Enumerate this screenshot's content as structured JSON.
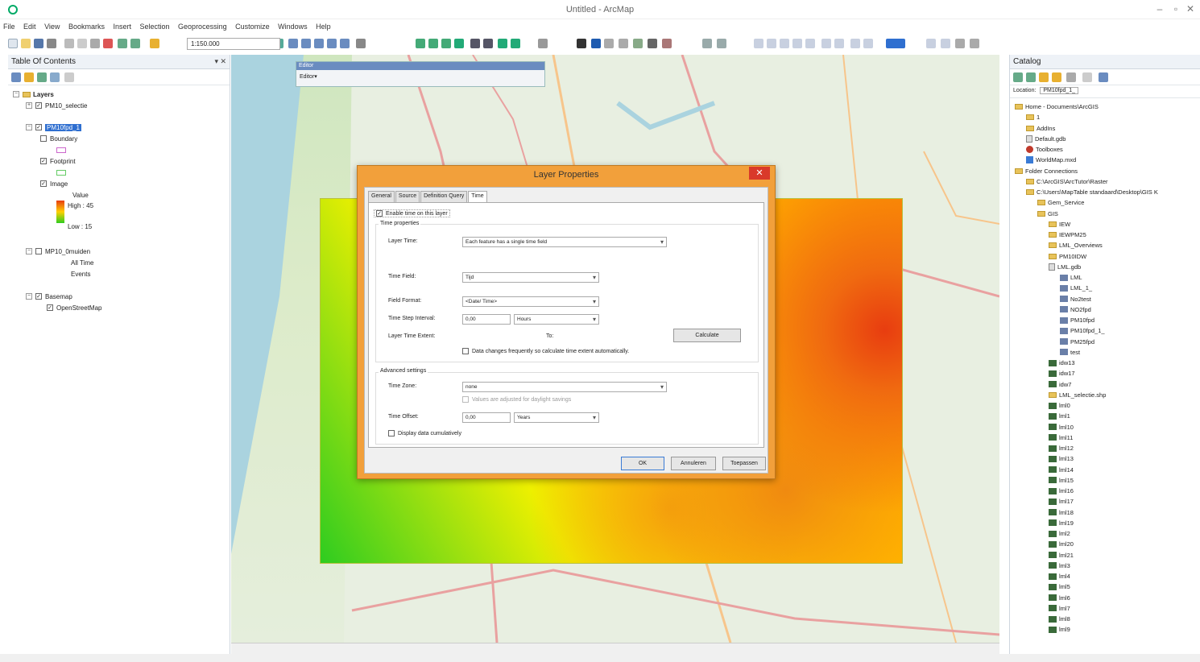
{
  "window": {
    "title": "Untitled - ArcMap",
    "min": "–",
    "max": "▫",
    "close": "✕"
  },
  "menu": [
    "File",
    "Edit",
    "View",
    "Bookmarks",
    "Insert",
    "Selection",
    "Geoprocessing",
    "Customize",
    "Windows",
    "Help"
  ],
  "toolbar": {
    "scale": "1:150.000"
  },
  "toc": {
    "title": "Table Of Contents",
    "pin": "▾ ✕",
    "layers_label": "Layers",
    "items": [
      {
        "label": "PM10_selectie"
      },
      {
        "label": "PM10fpd_1"
      },
      {
        "label": "Boundary"
      },
      {
        "label": "Footprint"
      },
      {
        "label": "Image"
      },
      {
        "label": "Value"
      },
      {
        "label": "High : 45"
      },
      {
        "label": "Low : 15"
      },
      {
        "label": "MP10_0muiden"
      },
      {
        "label": "All Time"
      },
      {
        "label": "Events"
      },
      {
        "label": "Basemap"
      },
      {
        "label": "OpenStreetMap"
      }
    ]
  },
  "editor": {
    "title": "Editor",
    "menu": "Editor▾"
  },
  "dialog": {
    "title": "Layer Properties",
    "close": "✕",
    "tabs": [
      "General",
      "Source",
      "Definition Query",
      "Time"
    ],
    "enable_time": "Enable time on this layer",
    "time_properties": "Time properties",
    "layer_time_label": "Layer Time:",
    "layer_time_value": "Each feature has a single time field",
    "time_field_label": "Time Field:",
    "time_field_value": "Tijd",
    "field_format_label": "Field Format:",
    "field_format_value": "<Date/ Time>",
    "time_step_label": "Time Step Interval:",
    "time_step_value": "0,00",
    "time_step_unit": "Hours",
    "layer_extent_label": "Layer Time Extent:",
    "layer_extent_to": "To:",
    "calculate": "Calculate",
    "data_changes": "Data changes frequently so calculate time extent automatically.",
    "advanced": "Advanced settings",
    "time_zone_label": "Time Zone:",
    "time_zone_value": "none",
    "daylight": "Values are adjusted for daylight savings",
    "time_offset_label": "Time Offset:",
    "time_offset_value": "0,00",
    "time_offset_unit": "Years",
    "display_cumulative": "Display data cumulatively",
    "ok": "OK",
    "cancel": "Annuleren",
    "apply": "Toepassen"
  },
  "catalog": {
    "title": "Catalog",
    "location_label": "Location:",
    "location_value": "PM10fpd_1_",
    "items": [
      {
        "label": "Home - Documents\\ArcGIS",
        "icon": "folder",
        "level": 0
      },
      {
        "label": "1",
        "icon": "folder",
        "level": 1
      },
      {
        "label": "AddIns",
        "icon": "folder",
        "level": 1
      },
      {
        "label": "Default.gdb",
        "icon": "gdb",
        "level": 1
      },
      {
        "label": "Toolboxes",
        "icon": "toolbox",
        "level": 1
      },
      {
        "label": "WorldMap.mxd",
        "icon": "mxd",
        "level": 1
      },
      {
        "label": "Folder Connections",
        "icon": "folder",
        "level": 0
      },
      {
        "label": "C:\\ArcGIS\\ArcTutor\\Raster",
        "icon": "folder",
        "level": 1
      },
      {
        "label": "C:\\Users\\MapTable standaard\\Desktop\\GIS K",
        "icon": "folder",
        "level": 1
      },
      {
        "label": "Gem_Service",
        "icon": "folder",
        "level": 2
      },
      {
        "label": "GIS",
        "icon": "folder",
        "level": 2
      },
      {
        "label": "IEW",
        "icon": "folder",
        "level": 3
      },
      {
        "label": "IEWPM25",
        "icon": "folder",
        "level": 3
      },
      {
        "label": "LML_Overviews",
        "icon": "folder",
        "level": 3
      },
      {
        "label": "PM10IDW",
        "icon": "folder",
        "level": 3
      },
      {
        "label": "LML.gdb",
        "icon": "gdb",
        "level": 3
      },
      {
        "label": "LML",
        "icon": "fc",
        "level": 4
      },
      {
        "label": "LML_1_",
        "icon": "fc",
        "level": 4
      },
      {
        "label": "No2test",
        "icon": "fc",
        "level": 4
      },
      {
        "label": "NO2fpd",
        "icon": "fc",
        "level": 4
      },
      {
        "label": "PM10fpd",
        "icon": "fc",
        "level": 4
      },
      {
        "label": "PM10fpd_1_",
        "icon": "fc",
        "level": 4
      },
      {
        "label": "PM25fpd",
        "icon": "fc",
        "level": 4
      },
      {
        "label": "test",
        "icon": "fc",
        "level": 4
      },
      {
        "label": "idw13",
        "icon": "raster",
        "level": 3
      },
      {
        "label": "idw17",
        "icon": "raster",
        "level": 3
      },
      {
        "label": "idw7",
        "icon": "raster",
        "level": 3
      },
      {
        "label": "LML_selectie.shp",
        "icon": "folder",
        "level": 3
      },
      {
        "label": "lml0",
        "icon": "raster",
        "level": 3
      },
      {
        "label": "lml1",
        "icon": "raster",
        "level": 3
      },
      {
        "label": "lml10",
        "icon": "raster",
        "level": 3
      },
      {
        "label": "lml11",
        "icon": "raster",
        "level": 3
      },
      {
        "label": "lml12",
        "icon": "raster",
        "level": 3
      },
      {
        "label": "lml13",
        "icon": "raster",
        "level": 3
      },
      {
        "label": "lml14",
        "icon": "raster",
        "level": 3
      },
      {
        "label": "lml15",
        "icon": "raster",
        "level": 3
      },
      {
        "label": "lml16",
        "icon": "raster",
        "level": 3
      },
      {
        "label": "lml17",
        "icon": "raster",
        "level": 3
      },
      {
        "label": "lml18",
        "icon": "raster",
        "level": 3
      },
      {
        "label": "lml19",
        "icon": "raster",
        "level": 3
      },
      {
        "label": "lml2",
        "icon": "raster",
        "level": 3
      },
      {
        "label": "lml20",
        "icon": "raster",
        "level": 3
      },
      {
        "label": "lml21",
        "icon": "raster",
        "level": 3
      },
      {
        "label": "lml3",
        "icon": "raster",
        "level": 3
      },
      {
        "label": "lml4",
        "icon": "raster",
        "level": 3
      },
      {
        "label": "lml5",
        "icon": "raster",
        "level": 3
      },
      {
        "label": "lml6",
        "icon": "raster",
        "level": 3
      },
      {
        "label": "lml7",
        "icon": "raster",
        "level": 3
      },
      {
        "label": "lml8",
        "icon": "raster",
        "level": 3
      },
      {
        "label": "lml9",
        "icon": "raster",
        "level": 3
      }
    ]
  },
  "colors": {
    "accent": "#2f6fd0",
    "dialog_frame": "#f2a03b",
    "close_red": "#d9392a",
    "heat_high": "#e83d10",
    "heat_low": "#2ecc20"
  }
}
